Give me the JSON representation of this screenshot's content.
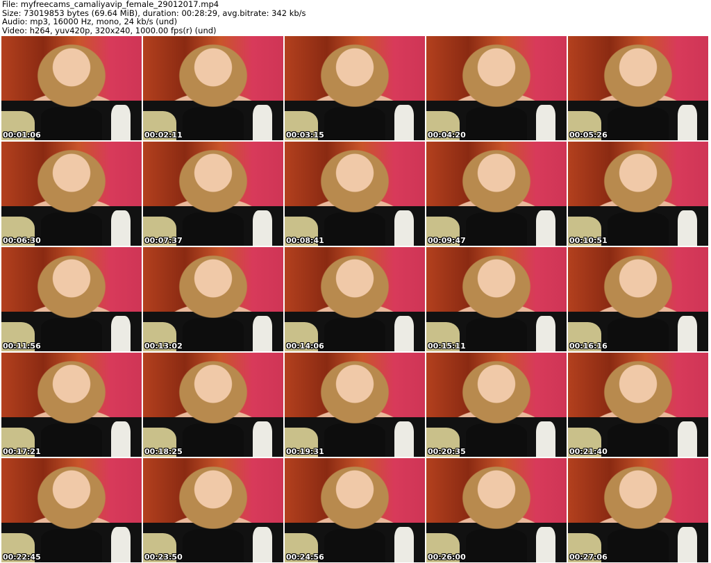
{
  "header": {
    "file": "File: myfreecams_camaliyavip_female_29012017.mp4",
    "size": "Size: 73019853 bytes (69.64 MiB), duration: 00:28:29, avg.bitrate: 342 kb/s",
    "audio": "Audio: mp3, 16000 Hz, mono, 24 kb/s (und)",
    "video": "Video: h264, yuv420p, 320x240, 1000.00 fps(r) (und)"
  },
  "thumbnails": [
    "00:01:06",
    "00:02:11",
    "00:03:15",
    "00:04:20",
    "00:05:26",
    "00:06:30",
    "00:07:37",
    "00:08:41",
    "00:09:47",
    "00:10:51",
    "00:11:56",
    "00:13:02",
    "00:14:06",
    "00:15:11",
    "00:16:16",
    "00:17:21",
    "00:18:25",
    "00:19:31",
    "00:20:35",
    "00:21:40",
    "00:22:45",
    "00:23:50",
    "00:24:56",
    "00:26:00",
    "00:27:06"
  ]
}
